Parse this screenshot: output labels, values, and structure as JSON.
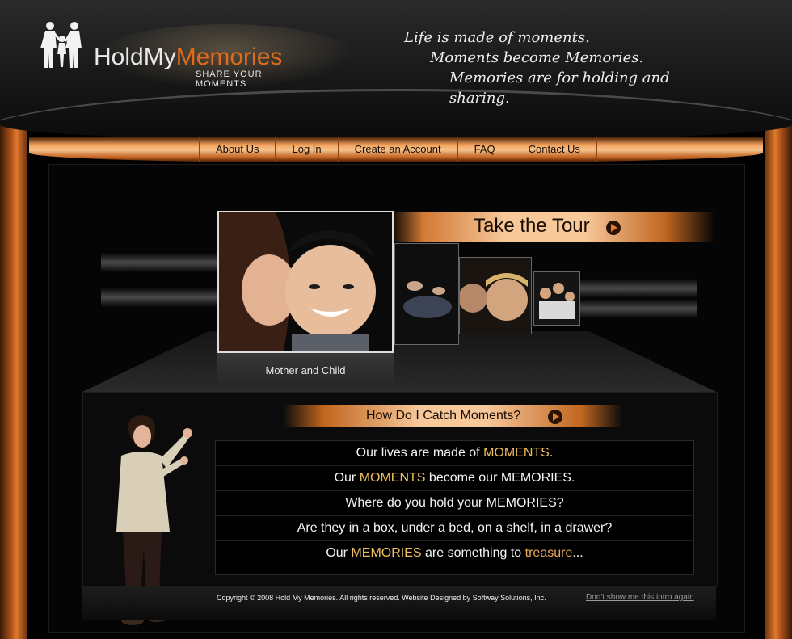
{
  "header": {
    "logo": {
      "brand_part1": "HoldMy",
      "brand_part2": "Memories",
      "tagline": "SHARE YOUR MOMENTS"
    },
    "quote_lines": [
      "Life is made of moments.",
      "Moments become Memories.",
      "Memories are for holding and sharing."
    ]
  },
  "nav": {
    "items": [
      "About Us",
      "Log In",
      "Create an Account",
      "FAQ",
      "Contact Us"
    ]
  },
  "tour": {
    "label": "Take the Tour",
    "caption": "Mother and Child"
  },
  "catch": {
    "label": "How Do I Catch Moments?",
    "lines": [
      {
        "parts": [
          {
            "t": "Our lives are made of ",
            "h": ""
          },
          {
            "t": "MOMENTS",
            "h": "hl"
          },
          {
            "t": ".",
            "h": ""
          }
        ]
      },
      {
        "parts": [
          {
            "t": "Our ",
            "h": ""
          },
          {
            "t": "MOMENTS",
            "h": "hl"
          },
          {
            "t": " become our MEMORIES.",
            "h": ""
          }
        ]
      },
      {
        "parts": [
          {
            "t": "Where do you hold your MEMORIES?",
            "h": ""
          }
        ]
      },
      {
        "parts": [
          {
            "t": "Are they in a box, under a bed, on a shelf, in a drawer?",
            "h": ""
          }
        ]
      },
      {
        "parts": [
          {
            "t": "Our ",
            "h": ""
          },
          {
            "t": "MEMORIES",
            "h": "hl"
          },
          {
            "t": " are something to ",
            "h": ""
          },
          {
            "t": "treasure",
            "h": "hl2"
          },
          {
            "t": "...",
            "h": ""
          }
        ]
      }
    ]
  },
  "footer": {
    "copyright": "Copyright © 2008 Hold My Memories. All rights reserved. Website Designed by Softway Solutions, Inc.",
    "skip_link": "Don't show me this intro again"
  },
  "colors": {
    "accent": "#e06a1a",
    "highlight": "#f0c060"
  }
}
